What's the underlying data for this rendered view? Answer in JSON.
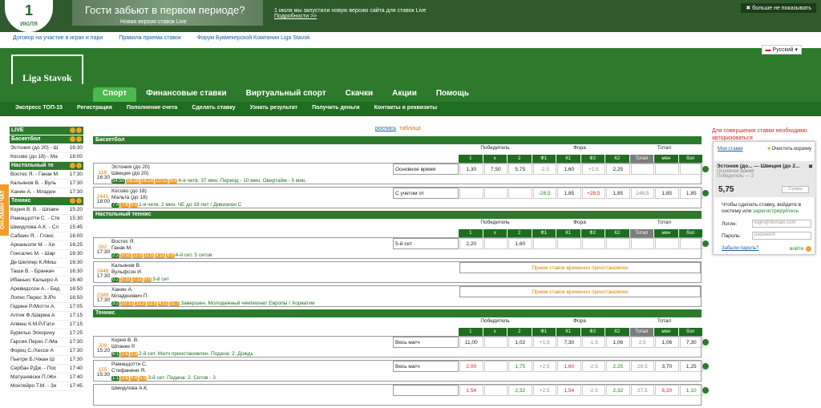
{
  "date": {
    "day": "1",
    "month": "июля"
  },
  "banner": {
    "title": "Гости забьют в первом периоде?",
    "sub": "Новая версия ставок Live"
  },
  "news": {
    "text": "1 июля мы запустили новую версию сайта для ставок Live",
    "link": "Подробности >>"
  },
  "hide": "больше не показывать",
  "toplinks": [
    "Договор на участие в играх и пари",
    "Правила приема ставок",
    "Форум Букмекерской Компании Liga Stavok"
  ],
  "lang": "Русский",
  "logo": "Liga Stavok",
  "nav": [
    "Спорт",
    "Финансовые ставки",
    "Виртуальный спорт",
    "Скачки",
    "Акции",
    "Помощь"
  ],
  "subnav": [
    "Экспресс ТОП-15",
    "Регистрация",
    "Пополнение счета",
    "Сделать ставку",
    "Узнать результат",
    "Получить деньги",
    "Контакты и реквизиты"
  ],
  "chat": "ОН-ЛАЙН ЧАТ",
  "sidebar": {
    "live": "LIVE",
    "basket": "Баскетбол",
    "basket_rows": [
      [
        "Эстония (до 20) - Ш",
        "16:30"
      ],
      [
        "Косово (до 18) - Ма",
        "18:00"
      ]
    ],
    "tt": "Настольный те",
    "tt_rows": [
      [
        "Востес Я. - Ганак М.",
        "17:30"
      ],
      [
        "Кальянов В. - Вуль",
        "17:30"
      ],
      [
        "Ханин А. - Младен",
        "17:30"
      ]
    ],
    "ten": "Теннис",
    "ten_rows": [
      [
        "Кория В. В. - Шпаин",
        "15:20"
      ],
      [
        "Рамаццотти С. - Сте",
        "15:30"
      ],
      [
        "Шмидлова А.К. - Сл",
        "15:45"
      ],
      [
        "Сабаин Я. - Глэнс",
        "16:00"
      ],
      [
        "Арканьоли М. - Хи",
        "16:25"
      ],
      [
        "Гонсалес М. - Шар",
        "16:30"
      ],
      [
        "Де Шеппер К./Миш",
        "16:30"
      ],
      [
        "Таши В. - Бранкач",
        "16:30"
      ],
      [
        "Ибаньес Кальеро А",
        "16:40"
      ],
      [
        "Аревидссон А. - Бед",
        "16:50"
      ],
      [
        "Лопес Перес Э./Ро",
        "16:50"
      ],
      [
        "Гедини Р./Мотти А.",
        "17:05"
      ],
      [
        "Алтик Ф./Шарма А",
        "17:15"
      ],
      [
        "Алвеш К.М.Р./Гати",
        "17:15"
      ],
      [
        "Бурильо Эскориху",
        "17:25"
      ],
      [
        "Гарсия Перес Г./Ма",
        "17:30"
      ],
      [
        "Форец С./Хессе А",
        "17:30"
      ],
      [
        "Пьетри Б./Чжан Ш",
        "17:30"
      ],
      [
        "Сербан Р.Дж. - Пос",
        "17:40"
      ],
      [
        "Матушевски П./Жи",
        "17:40"
      ],
      [
        "Монтейро Т.М. - Зе",
        "17:45"
      ]
    ]
  },
  "view": {
    "a": "роспись",
    "b": "таблица"
  },
  "headers": {
    "winner": "Победитель",
    "fora": "Фора",
    "total": "Тотал",
    "cols": [
      "1",
      "x",
      "2",
      "Ф1",
      "К1",
      "Ф2",
      "К2",
      "Тотал",
      "мен",
      "бол"
    ]
  },
  "sections": [
    {
      "name": "Баскетбол",
      "events": [
        {
          "id": "118",
          "time": "16:30",
          "teams": [
            "Эстония (до 20)",
            "Швеция (до 20)"
          ],
          "scores": [
            "54:50",
            "16:18",
            "18:14",
            "13:12",
            "9:8"
          ],
          "status": "4-я четв. 37 мин. Период - 10 мин. Овертайм - 5 мин.",
          "market": "Основное время",
          "odds": [
            [
              "1,30",
              ""
            ],
            [
              "7,50",
              ""
            ],
            [
              "5,75",
              ""
            ],
            [
              "-2,5",
              "gr"
            ],
            [
              "1,60",
              ""
            ],
            [
              "+2,5",
              "gr"
            ],
            [
              "2,25",
              ""
            ],
            [
              "",
              ""
            ],
            [
              "",
              ""
            ],
            [
              "",
              ""
            ]
          ]
        },
        {
          "id": "2441",
          "time": "18:00",
          "teams": [
            "Косово (до 18)",
            "Мальта (до 18)"
          ],
          "scores": [
            "7:4",
            "7:4",
            "0:0"
          ],
          "status": "1-я четв. 2 мин. ЧЕ до 18 лет / Дивизион С",
          "market": "С учетом от",
          "odds": [
            [
              "",
              ""
            ],
            [
              "",
              ""
            ],
            [
              "",
              ""
            ],
            [
              "-28,5",
              "up"
            ],
            [
              "1,85",
              ""
            ],
            [
              "+28,5",
              "dn"
            ],
            [
              "1,85",
              ""
            ],
            [
              "148,5",
              "gr"
            ],
            [
              "1,85",
              ""
            ],
            [
              "1,85",
              ""
            ]
          ]
        }
      ]
    },
    {
      "name": "Настольный теннис",
      "events": [
        {
          "id": "262",
          "time": "17:30",
          "teams": [
            "Востес Я.",
            "Ганак М."
          ],
          "scores": [
            "2:2",
            "5:11",
            "11:5",
            "11:5",
            "6:11",
            "8:3"
          ],
          "status": "4-й сет. 5 сетов",
          "market": "5-й сет",
          "odds": [
            [
              "2,20",
              ""
            ],
            [
              "",
              ""
            ],
            [
              "1,60",
              ""
            ],
            [
              "",
              ""
            ],
            [
              "",
              ""
            ],
            [
              "",
              ""
            ],
            [
              "",
              ""
            ],
            [
              "",
              ""
            ],
            [
              "",
              ""
            ],
            [
              "",
              ""
            ]
          ]
        },
        {
          "id": "2448",
          "time": "17:30",
          "teams": [
            "Кальянов В.",
            "Вульфсон И."
          ],
          "scores": [
            "0:2",
            "5:11",
            "7:11",
            "0:0"
          ],
          "status": "3-й сет",
          "suspended": "Прием ставок временно приостановлен"
        },
        {
          "id": "2389",
          "time": "17:30",
          "teams": [
            "Ханин А.",
            "Младенович П."
          ],
          "scores": [
            "3:2",
            "10:12",
            "11:2",
            "11:9",
            "4:11",
            "11:7"
          ],
          "status": "Завершен. Молодежный чемпионат Европы / Хорватии",
          "suspended": "Прием ставок временно приостановлен"
        }
      ]
    },
    {
      "name": "Теннис",
      "events": [
        {
          "id": "209",
          "time": "15:20",
          "teams": [
            "Кория В. В.",
            "Шпанек Р."
          ],
          "scores": [
            "6:1",
            "1:5",
            "2:3"
          ],
          "status": "2-й сет. Матч приостановлен. Подача: 2. Дождь",
          "market": "Весь матч",
          "odds": [
            [
              "11,00",
              ""
            ],
            [
              "",
              ""
            ],
            [
              "1,02",
              ""
            ],
            [
              "+1,5",
              "gr"
            ],
            [
              "7,30",
              ""
            ],
            [
              "-1,5",
              "gr"
            ],
            [
              "1,06",
              ""
            ],
            [
              "2,5",
              "gr"
            ],
            [
              "1,06",
              ""
            ],
            [
              "7,30",
              ""
            ]
          ]
        },
        {
          "id": "155",
          "time": "15:30",
          "teams": [
            "Рамаццотти С.",
            "Стефанини Я."
          ],
          "scores": [
            "1:1",
            "3:6",
            "6:4",
            "5:3"
          ],
          "status": "3-й сет. Подача: 2. Сетов - 3",
          "market": "Весь матч",
          "odds": [
            [
              "2,00",
              "dn"
            ],
            [
              "",
              ""
            ],
            [
              "1,75",
              "up"
            ],
            [
              "+2,5",
              "gr"
            ],
            [
              "1,60",
              "dn"
            ],
            [
              "-2,5",
              "gr"
            ],
            [
              "2,25",
              "up"
            ],
            [
              "28,5",
              "gr"
            ],
            [
              "3,70",
              ""
            ],
            [
              "1,25",
              ""
            ]
          ]
        },
        {
          "id": "",
          "time": "",
          "teams": [
            "Шмидлова А.К.",
            ""
          ],
          "scores": [],
          "status": "",
          "market": "",
          "odds": [
            [
              "1,54",
              "dn"
            ],
            [
              "",
              ""
            ],
            [
              "2,32",
              "up"
            ],
            [
              "+2,5",
              "gr"
            ],
            [
              "1,54",
              "dn"
            ],
            [
              "-2,5",
              "gr"
            ],
            [
              "2,32",
              "up"
            ],
            [
              "27,5",
              "gr"
            ],
            [
              "6,20",
              "dn"
            ],
            [
              "1,10",
              "up"
            ]
          ]
        }
      ]
    }
  ],
  "slip": {
    "warn": [
      "Для совершения ставки необходимо",
      "авторизоваться"
    ],
    "tab": "Мои ставки",
    "clear": "Очистить корзину",
    "event": "Эстония (до... — Швеция (до 2...",
    "sub1": "Основное время",
    "sub2": "Победитель — 2",
    "odd": "5,75",
    "sum": "Сумма",
    "note1": "Чтобы сделать ставку, войдите в",
    "note2": "систему или",
    "note3": "зарегистрируйтесь",
    "login": "Логин:",
    "pass": "Пароль:",
    "login_ph": "login@domain.com",
    "pass_ph": "password",
    "forgot": "Забыли пароль?",
    "go": "войти"
  }
}
